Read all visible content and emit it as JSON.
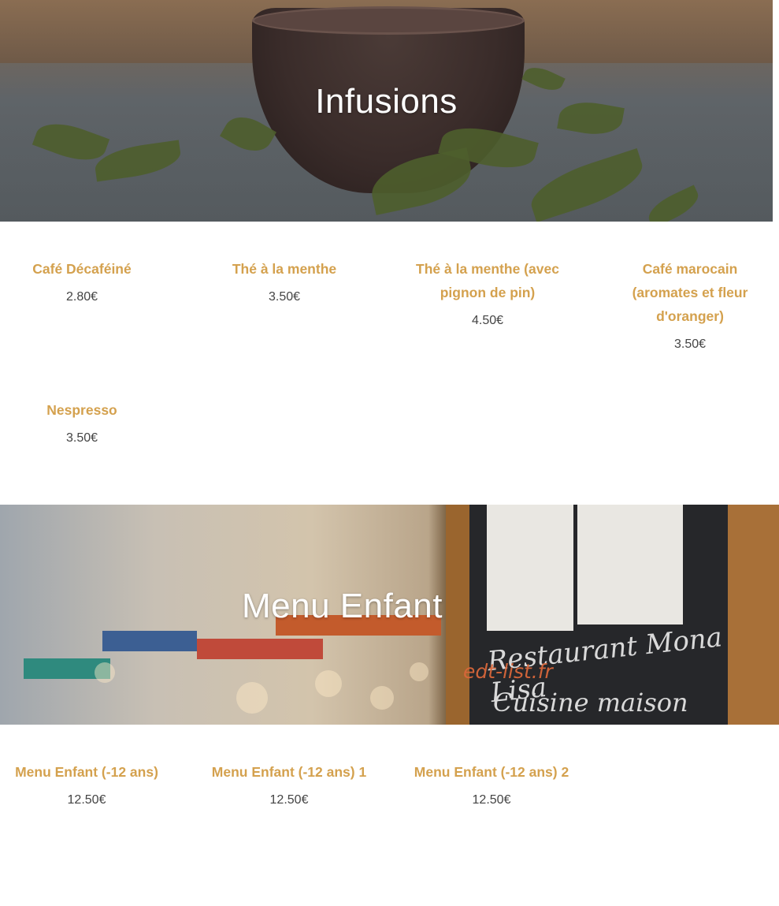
{
  "sections": [
    {
      "title": "Infusions",
      "items": [
        {
          "name": "Café Décaféiné",
          "price": "2.80€"
        },
        {
          "name": "Thé à la menthe",
          "price": "3.50€"
        },
        {
          "name": "Thé à la menthe (avec pignon de pin)",
          "price": "4.50€"
        },
        {
          "name": "Café marocain (aromates et fleur d'oranger)",
          "price": "3.50€"
        },
        {
          "name": "Nespresso",
          "price": "3.50€"
        }
      ]
    },
    {
      "title": "Menu Enfant",
      "watermark": "edt-list.fr",
      "chalkboard": [
        "Restaurant Mona Lisa",
        "Cuisine maison"
      ],
      "items": [
        {
          "name": "Menu Enfant (-12 ans)",
          "price": "12.50€"
        },
        {
          "name": "Menu Enfant (-12 ans) 1",
          "price": "12.50€"
        },
        {
          "name": "Menu Enfant (-12 ans) 2",
          "price": "12.50€"
        }
      ]
    }
  ],
  "colors": {
    "item_name": "#d4a14e",
    "price": "#444444",
    "hero_text": "#ffffff",
    "watermark": "#d9673a"
  }
}
